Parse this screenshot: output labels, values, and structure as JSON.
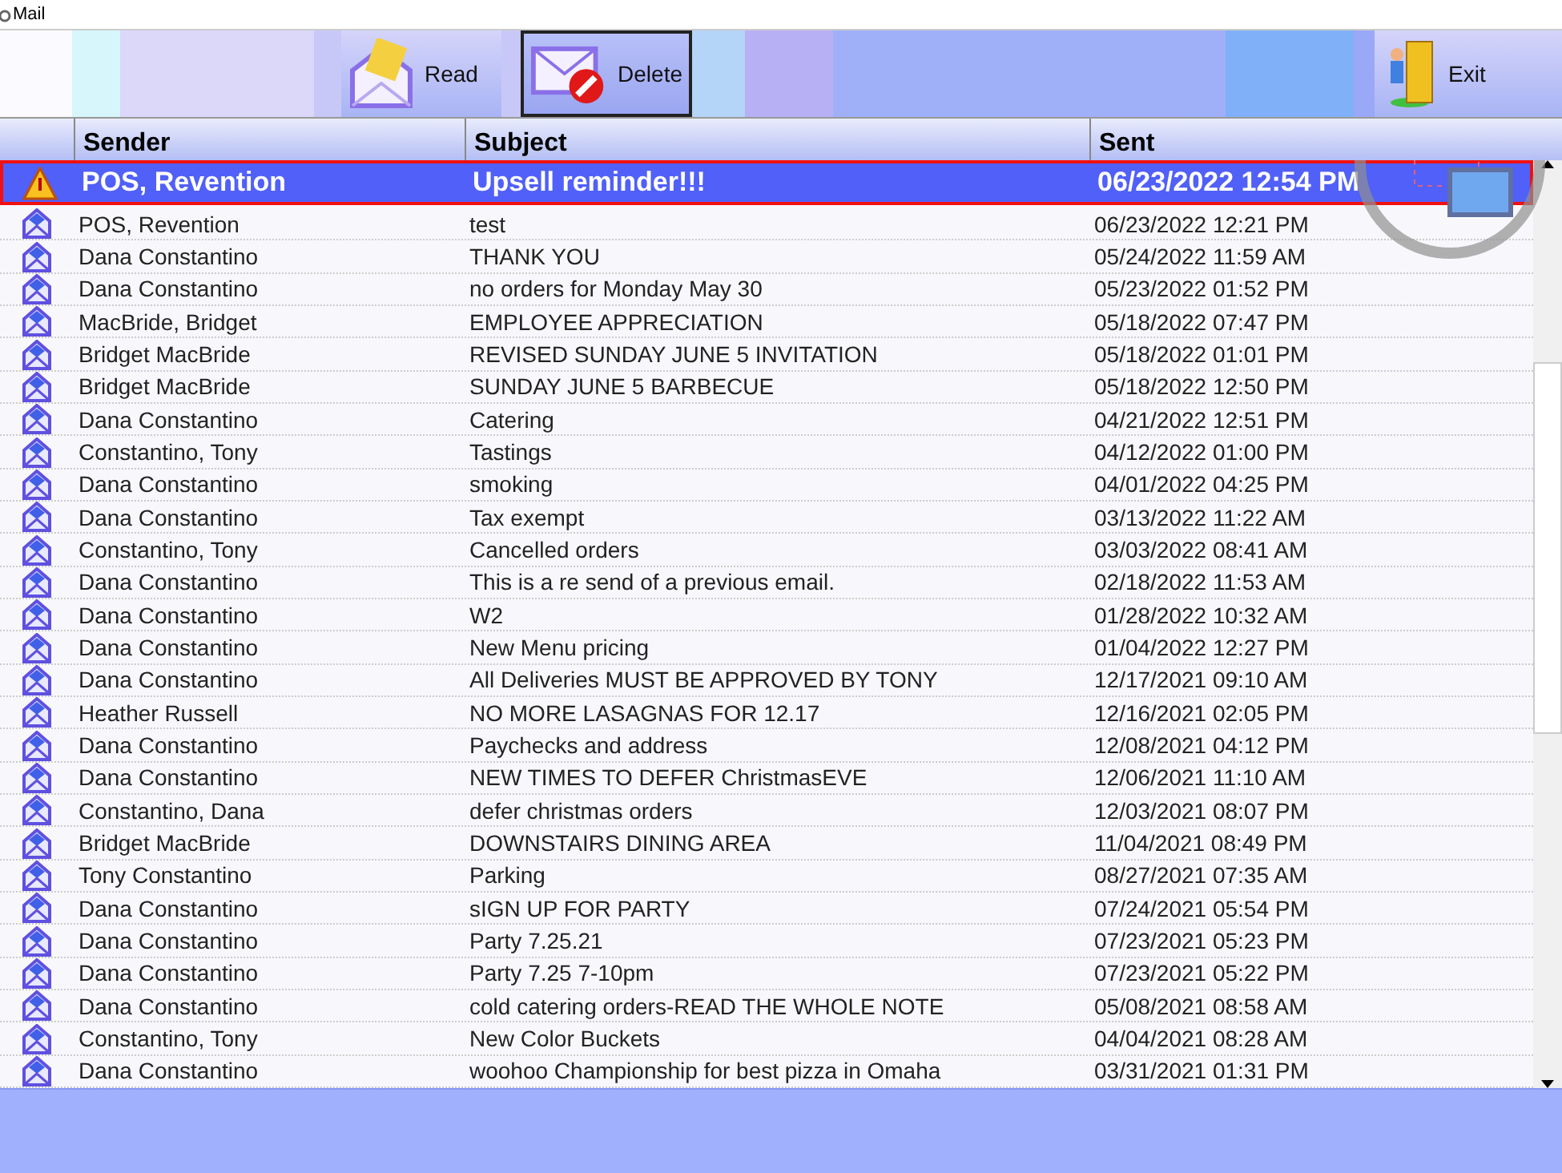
{
  "window": {
    "title": "Mail"
  },
  "toolbar": [
    {
      "label": "Read",
      "kind": "read",
      "selected": false
    },
    {
      "label": "Delete",
      "kind": "delete",
      "selected": true
    },
    {
      "label": "Exit",
      "kind": "exit",
      "selected": false
    }
  ],
  "table": {
    "columns": [
      "Sender",
      "Subject",
      "Sent"
    ],
    "rows": [
      {
        "kind": "alert",
        "selected": true,
        "sender": "POS, Revention",
        "subject": "Upsell reminder!!!",
        "sent": "06/23/2022 12:54 PM"
      },
      {
        "kind": "mail",
        "selected": false,
        "sender": "POS, Revention",
        "subject": "test",
        "sent": "06/23/2022 12:21 PM"
      },
      {
        "kind": "mail",
        "selected": false,
        "sender": "Dana Constantino",
        "subject": "THANK YOU",
        "sent": "05/24/2022 11:59 AM"
      },
      {
        "kind": "mail",
        "selected": false,
        "sender": "Dana Constantino",
        "subject": "no orders for Monday May 30",
        "sent": "05/23/2022 01:52 PM"
      },
      {
        "kind": "mail",
        "selected": false,
        "sender": "MacBride, Bridget",
        "subject": "EMPLOYEE APPRECIATION",
        "sent": "05/18/2022 07:47 PM"
      },
      {
        "kind": "mail",
        "selected": false,
        "sender": "Bridget MacBride",
        "subject": "REVISED SUNDAY JUNE 5 INVITATION",
        "sent": "05/18/2022 01:01 PM"
      },
      {
        "kind": "mail",
        "selected": false,
        "sender": "Bridget MacBride",
        "subject": "SUNDAY JUNE 5 BARBECUE",
        "sent": "05/18/2022 12:50 PM"
      },
      {
        "kind": "mail",
        "selected": false,
        "sender": "Dana Constantino",
        "subject": "Catering",
        "sent": "04/21/2022 12:51 PM"
      },
      {
        "kind": "mail",
        "selected": false,
        "sender": "Constantino, Tony",
        "subject": "Tastings",
        "sent": "04/12/2022 01:00 PM"
      },
      {
        "kind": "mail",
        "selected": false,
        "sender": "Dana Constantino",
        "subject": "smoking",
        "sent": "04/01/2022 04:25 PM"
      },
      {
        "kind": "mail",
        "selected": false,
        "sender": "Dana Constantino",
        "subject": "Tax exempt",
        "sent": "03/13/2022 11:22 AM"
      },
      {
        "kind": "mail",
        "selected": false,
        "sender": "Constantino, Tony",
        "subject": "Cancelled orders",
        "sent": "03/03/2022 08:41 AM"
      },
      {
        "kind": "mail",
        "selected": false,
        "sender": "Dana Constantino",
        "subject": "This is a re send of a previous email.",
        "sent": "02/18/2022 11:53 AM"
      },
      {
        "kind": "mail",
        "selected": false,
        "sender": "Dana Constantino",
        "subject": "W2",
        "sent": "01/28/2022 10:32 AM"
      },
      {
        "kind": "mail",
        "selected": false,
        "sender": "Dana Constantino",
        "subject": "New Menu pricing",
        "sent": "01/04/2022 12:27 PM"
      },
      {
        "kind": "mail",
        "selected": false,
        "sender": "Dana Constantino",
        "subject": "All Deliveries MUST BE APPROVED BY TONY",
        "sent": "12/17/2021 09:10 AM"
      },
      {
        "kind": "mail",
        "selected": false,
        "sender": "Heather Russell",
        "subject": "NO MORE LASAGNAS FOR 12.17",
        "sent": "12/16/2021 02:05 PM"
      },
      {
        "kind": "mail",
        "selected": false,
        "sender": "Dana Constantino",
        "subject": "Paychecks and address",
        "sent": "12/08/2021 04:12 PM"
      },
      {
        "kind": "mail",
        "selected": false,
        "sender": "Dana Constantino",
        "subject": "NEW TIMES TO DEFER ChristmasEVE",
        "sent": "12/06/2021 11:10 AM"
      },
      {
        "kind": "mail",
        "selected": false,
        "sender": "Constantino, Dana",
        "subject": "defer christmas orders",
        "sent": "12/03/2021 08:07 PM"
      },
      {
        "kind": "mail",
        "selected": false,
        "sender": "Bridget MacBride",
        "subject": "DOWNSTAIRS DINING AREA",
        "sent": "11/04/2021 08:49 PM"
      },
      {
        "kind": "mail",
        "selected": false,
        "sender": "Tony Constantino",
        "subject": "Parking",
        "sent": "08/27/2021 07:35 AM"
      },
      {
        "kind": "mail",
        "selected": false,
        "sender": "Dana Constantino",
        "subject": "sIGN UP FOR PARTY",
        "sent": "07/24/2021 05:54 PM"
      },
      {
        "kind": "mail",
        "selected": false,
        "sender": "Dana Constantino",
        "subject": "Party 7.25.21",
        "sent": "07/23/2021 05:23 PM"
      },
      {
        "kind": "mail",
        "selected": false,
        "sender": "Dana Constantino",
        "subject": "Party 7.25  7-10pm",
        "sent": "07/23/2021 05:22 PM"
      },
      {
        "kind": "mail",
        "selected": false,
        "sender": "Dana Constantino",
        "subject": "cold catering orders-READ THE WHOLE NOTE",
        "sent": "05/08/2021 08:58 AM"
      },
      {
        "kind": "mail",
        "selected": false,
        "sender": "Constantino, Tony",
        "subject": "New Color Buckets",
        "sent": "04/04/2021 08:28 AM"
      },
      {
        "kind": "mail",
        "selected": false,
        "sender": "Dana Constantino",
        "subject": "woohoo Championship for best pizza in Omaha",
        "sent": "03/31/2021 01:31 PM"
      }
    ]
  }
}
